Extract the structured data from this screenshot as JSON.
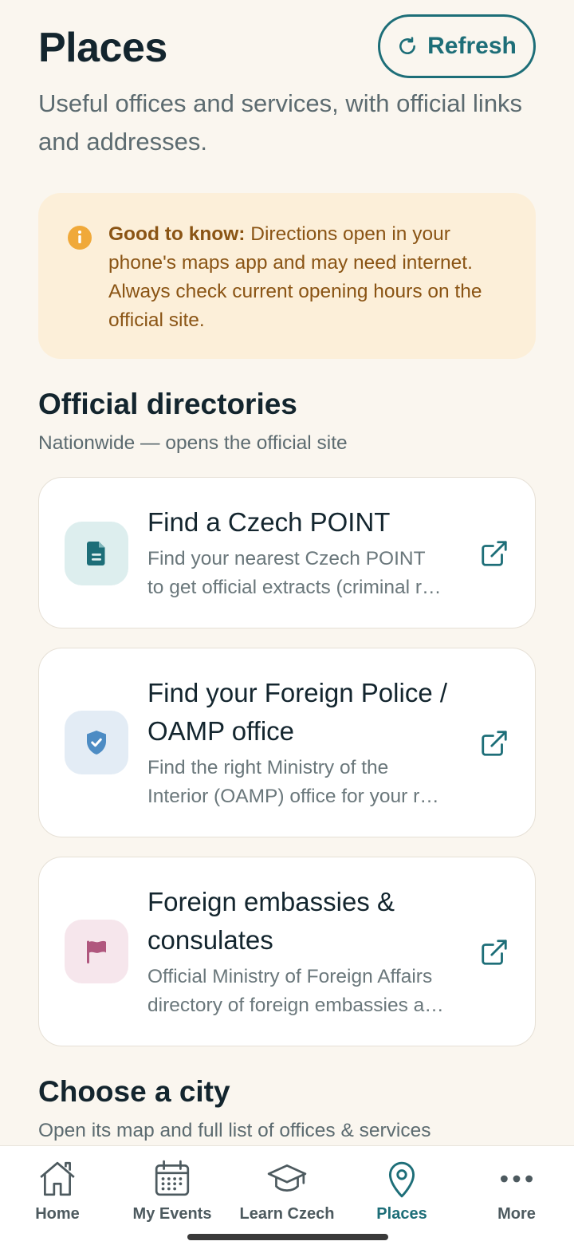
{
  "header": {
    "title": "Places",
    "refresh_label": "Refresh",
    "subtitle": "Useful offices and services, with official links and addresses."
  },
  "notice": {
    "bold": "Good to know:",
    "text": " Directions open in your phone's maps app and may need internet. Always check current opening hours on the official site."
  },
  "directories": {
    "title": "Official directories",
    "subtitle": "Nationwide — opens the official site",
    "items": [
      {
        "title": "Find a Czech POINT",
        "desc_line1": "Find your nearest Czech POINT",
        "desc_line2": "to get official extracts (criminal r…",
        "icon": "document-icon"
      },
      {
        "title": "Find your Foreign Police / OAMP office",
        "desc_line1": "Find the right Ministry of the",
        "desc_line2": "Interior (OAMP) office for your r…",
        "icon": "shield-check-icon"
      },
      {
        "title": "Foreign embassies & consulates",
        "desc_line1": "Official Ministry of Foreign Affairs",
        "desc_line2": "directory of foreign embassies a…",
        "icon": "flag-icon"
      }
    ]
  },
  "city": {
    "title": "Choose a city",
    "subtitle": "Open its map and full list of offices & services"
  },
  "nav": {
    "items": [
      {
        "label": "Home",
        "icon": "home-icon"
      },
      {
        "label": "My Events",
        "icon": "calendar-icon"
      },
      {
        "label": "Learn Czech",
        "icon": "graduation-cap-icon"
      },
      {
        "label": "Places",
        "icon": "map-pin-icon",
        "active": true
      },
      {
        "label": "More",
        "icon": "more-icon"
      }
    ]
  },
  "colors": {
    "accent": "#1d6e78",
    "background": "#faf6ef",
    "notice_bg": "#fcefd9",
    "notice_text": "#8a5414"
  }
}
